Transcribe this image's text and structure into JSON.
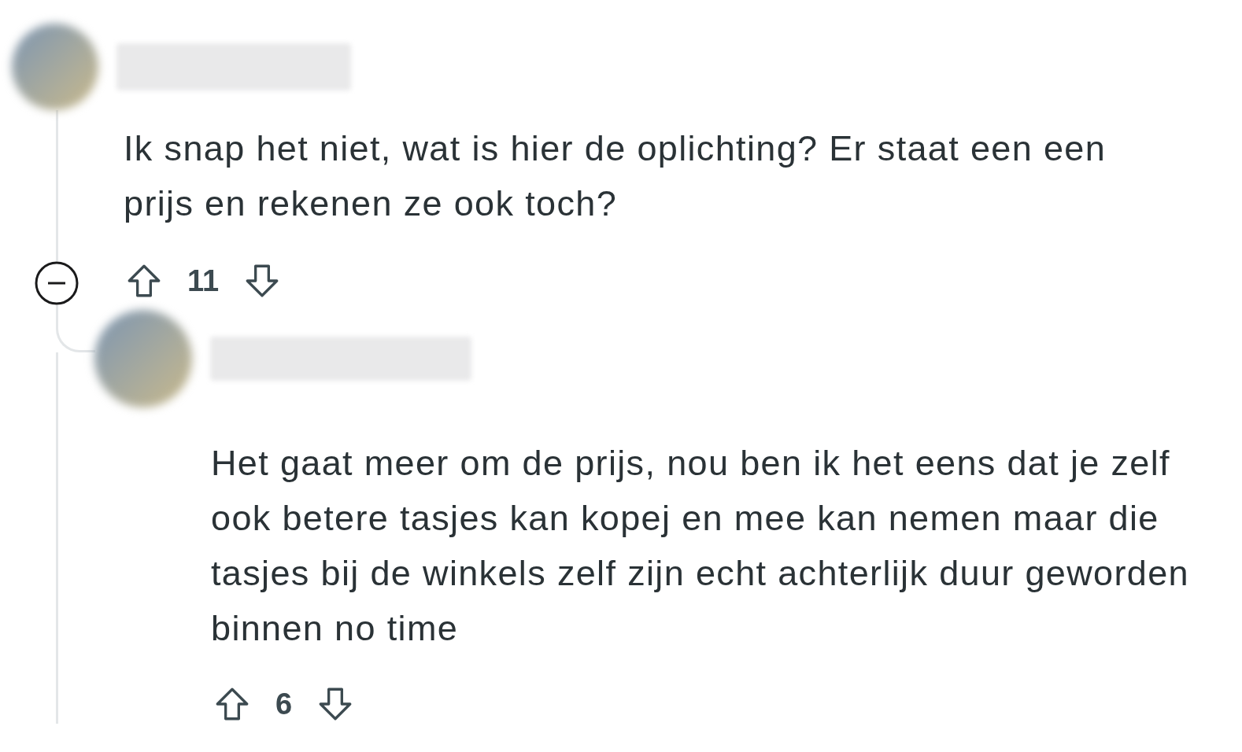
{
  "comment": {
    "text": "Ik snap het niet, wat is hier de oplichting? Er staat een een prijs en rekenen ze ook toch?",
    "score": "11",
    "expanded": true,
    "children": [
      {
        "text": "Het gaat meer om de prijs, nou ben ik het eens dat je zelf ook betere tasjes kan kopej en mee kan nemen maar die tasjes bij de winkels zelf zijn echt achterlijk duur geworden binnen no time",
        "score": "6"
      }
    ]
  }
}
